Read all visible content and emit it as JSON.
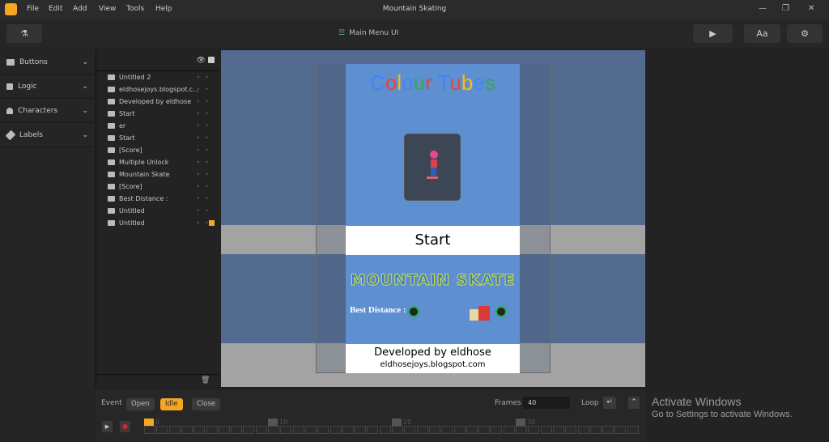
{
  "app": {
    "title": "Mountain Skating",
    "menu": [
      "File",
      "Edit",
      "Add",
      "View",
      "Tools",
      "Help"
    ]
  },
  "toolbar": {
    "scene_label": "Main Menu UI",
    "font_label": "Aa"
  },
  "categories": [
    {
      "label": "Buttons",
      "icon": "button-icon"
    },
    {
      "label": "Logic",
      "icon": "logic-icon"
    },
    {
      "label": "Characters",
      "icon": "person-icon"
    },
    {
      "label": "Labels",
      "icon": "tag-icon"
    }
  ],
  "layers": [
    {
      "label": "Untitled 2",
      "icon": "image-icon"
    },
    {
      "label": "eldhosejoys.blogspot.c...",
      "icon": "label-icon"
    },
    {
      "label": "Developed by eldhose",
      "icon": "label-icon"
    },
    {
      "label": "Start",
      "icon": "label-icon"
    },
    {
      "label": "er",
      "icon": "button-icon"
    },
    {
      "label": "Start",
      "icon": "button-icon"
    },
    {
      "label": "[Score]",
      "icon": "label-icon"
    },
    {
      "label": "Multiple Unlock",
      "icon": "lock-icon"
    },
    {
      "label": "Mountain Skate",
      "icon": "label-icon"
    },
    {
      "label": "[Score]",
      "icon": "label-icon"
    },
    {
      "label": "Best Distance :",
      "icon": "label-icon"
    },
    {
      "label": "Untitled",
      "icon": "image-icon"
    },
    {
      "label": "Untitled",
      "icon": "image-icon",
      "locked": true
    }
  ],
  "canvas": {
    "colour_title": [
      "C",
      "o",
      "l",
      "o",
      "u",
      "r",
      " ",
      "T",
      "u",
      "b",
      "e",
      "s"
    ],
    "colour_colors": [
      "#4285f4",
      "#ea4335",
      "#fbbc05",
      "#4285f4",
      "#34a853",
      "#ea4335",
      "",
      "#4285f4",
      "#ea4335",
      "#fbbc05",
      "#4285f4",
      "#34a853"
    ],
    "start": "Start",
    "mountain": "MOUNTAIN SKATE",
    "best": "Best Distance :",
    "developed": "Developed by eldhose",
    "blog": "eldhosejoys.blogspot.com"
  },
  "timeline": {
    "event_label": "Event",
    "events": [
      "Open",
      "Idle",
      "Close"
    ],
    "active_event": "Idle",
    "frames_label": "Frames",
    "frames_value": "40",
    "loop_label": "Loop",
    "markers": [
      "0",
      "10",
      "20",
      "30"
    ],
    "frame_count": 40,
    "accent": "#f5a623"
  },
  "watermark": {
    "title": "Activate Windows",
    "subtitle": "Go to Settings to activate Windows."
  }
}
